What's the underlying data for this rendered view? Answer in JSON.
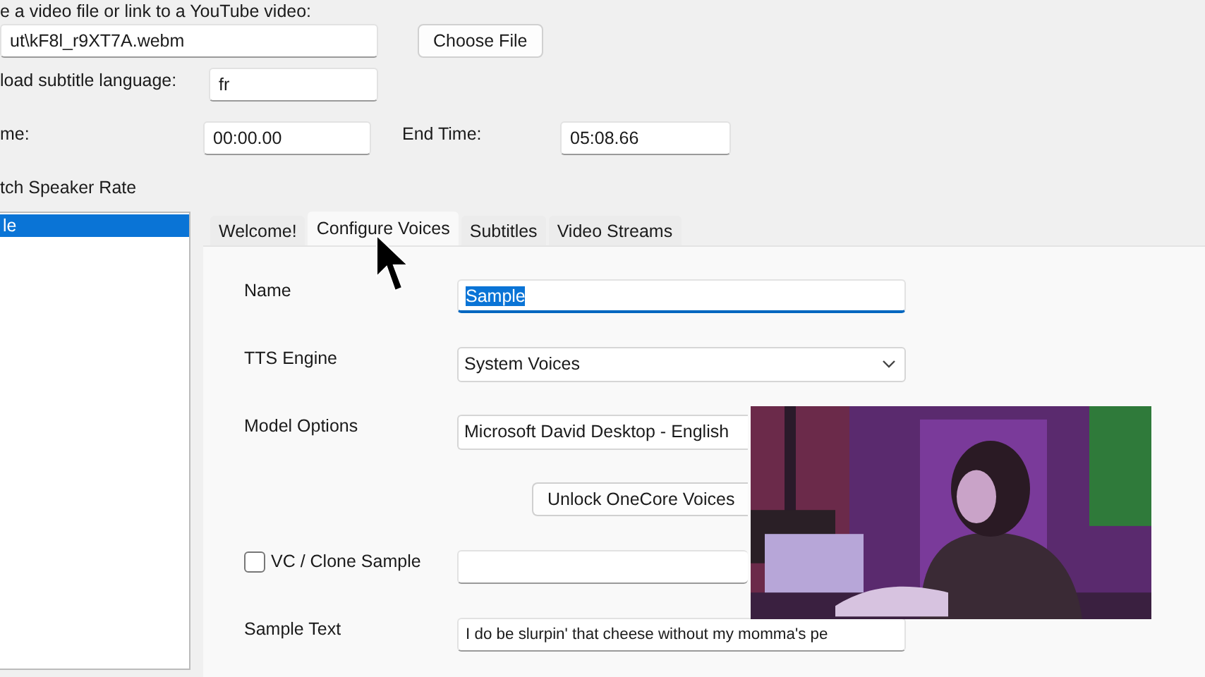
{
  "instructions": "e a video file or link to a YouTube video:",
  "file": {
    "value": "ut\\kF8l_r9XT7A.webm",
    "button": "Choose File"
  },
  "subtitle_language": {
    "label": "load subtitle language:",
    "value": "fr"
  },
  "start_time": {
    "label": "me:",
    "value": "00:00.00"
  },
  "end_time": {
    "label": "End Time:",
    "value": "05:08.66"
  },
  "match_speaker_rate": {
    "label": "tch Speaker Rate"
  },
  "speakers": [
    {
      "label": "le",
      "selected": true
    }
  ],
  "tabs": [
    {
      "label": "Welcome!",
      "selected": false
    },
    {
      "label": "Configure Voices",
      "selected": true
    },
    {
      "label": "Subtitles",
      "selected": false
    },
    {
      "label": "Video Streams",
      "selected": false
    }
  ],
  "voice_form": {
    "name": {
      "label": "Name",
      "value": "Sample",
      "text_selected": true
    },
    "tts_engine": {
      "label": "TTS Engine",
      "value": "System Voices"
    },
    "model_options": {
      "label": "Model Options",
      "value": "Microsoft David Desktop - English"
    },
    "unlock_button": "Unlock OneCore Voices",
    "vc_clone": {
      "label": "VC / Clone Sample",
      "checked": false
    },
    "sample_text": {
      "label": "Sample Text",
      "value": "I do be slurpin' that cheese without my momma's pe"
    }
  }
}
